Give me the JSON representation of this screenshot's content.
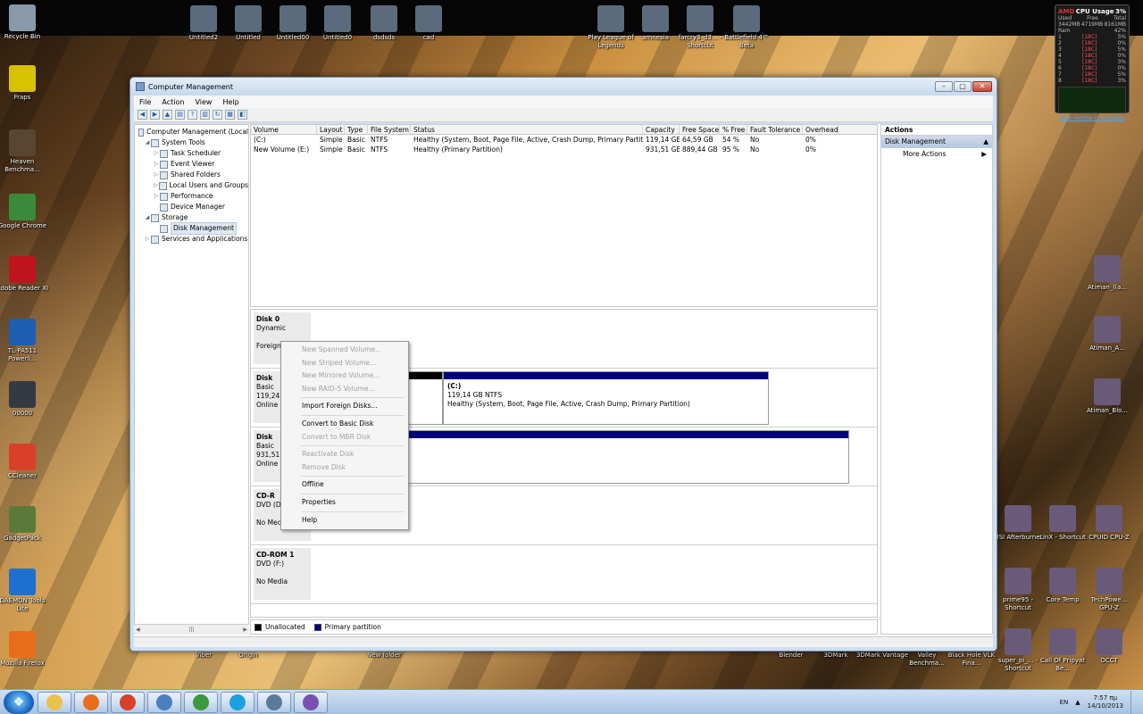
{
  "desktop": {
    "left_icons": [
      {
        "label": "Recycle Bin",
        "color": "#8899aa"
      },
      {
        "label": "Fraps",
        "color": "#d8c200"
      },
      {
        "label": "Heaven Benchma...",
        "color": "#5a4630"
      },
      {
        "label": "Google Chrome",
        "color": "#3b8a3b"
      },
      {
        "label": "Adobe Reader XI",
        "color": "#c0141c"
      },
      {
        "label": "TL-PA511 Powerli...",
        "color": "#1c5fb3"
      },
      {
        "label": "00000",
        "color": "#333a44"
      },
      {
        "label": "CCleaner",
        "color": "#d9402a"
      },
      {
        "label": "GadgetPack",
        "color": "#5a7a3a"
      },
      {
        "label": "DAEMON Tools Lite",
        "color": "#1e6fd0"
      },
      {
        "label": "Mozilla Firefox",
        "color": "#e86d1a"
      }
    ],
    "top_icons": [
      {
        "label": "Untitled2"
      },
      {
        "label": "Untitled"
      },
      {
        "label": "Untitled00"
      },
      {
        "label": "Untitled0"
      },
      {
        "label": "dsdsds"
      },
      {
        "label": "cad"
      },
      {
        "label": "Play League of Legends"
      },
      {
        "label": "amnesia"
      },
      {
        "label": "farcry3_d3... - Shortcut"
      },
      {
        "label": "Battlefield 4™ Beta"
      }
    ],
    "right_icons": [
      {
        "label": "Atiman_l(a..."
      },
      {
        "label": "Atiman_A..."
      },
      {
        "label": "Atiman_Blo..."
      },
      {
        "label": "MSI Afterburner"
      },
      {
        "label": "LinX - Shortcut"
      },
      {
        "label": "CPUID CPU-Z"
      },
      {
        "label": "prime95 - Shortcut"
      },
      {
        "label": "Core Temp"
      },
      {
        "label": "TechPowe... GPU-Z"
      },
      {
        "label": "super_pi_... - Shortcut"
      },
      {
        "label": "Call Of Pripyat Be..."
      },
      {
        "label": "OCCT"
      }
    ],
    "bottom_icons": [
      {
        "label": "Viber"
      },
      {
        "label": "Origin"
      },
      {
        "label": "New folder"
      },
      {
        "label": "Blender"
      },
      {
        "label": "3DMark"
      },
      {
        "label": "3DMark Vantage"
      },
      {
        "label": "Valley Benchma..."
      },
      {
        "label": "Black Hole VLK Fina..."
      }
    ]
  },
  "cpu_gadget": {
    "title": "CPU Usage",
    "percent": "3%",
    "brand": "AMD",
    "used_label": "Used",
    "free_label": "Free",
    "total_label": "Total",
    "used": "3442MB",
    "free": "4719MB",
    "total": "8161MB",
    "ram_label": "Ram",
    "ram_pct": "42%",
    "cores": [
      {
        "n": "1",
        "t": "[18C]",
        "p": "5%"
      },
      {
        "n": "2",
        "t": "[18C]",
        "p": "0%"
      },
      {
        "n": "3",
        "t": "[18C]",
        "p": "5%"
      },
      {
        "n": "4",
        "t": "[18C]",
        "p": "0%"
      },
      {
        "n": "5",
        "t": "[18C]",
        "p": "3%"
      },
      {
        "n": "6",
        "t": "[18C]",
        "p": "0%"
      },
      {
        "n": "7",
        "t": "[18C]",
        "p": "5%"
      },
      {
        "n": "8",
        "t": "[18C]",
        "p": "3%"
      }
    ],
    "link": "New version is available"
  },
  "window": {
    "title": "Computer Management",
    "menu": [
      "File",
      "Action",
      "View",
      "Help"
    ],
    "tree": [
      {
        "label": "Computer Management (Local",
        "level": 0,
        "exp": ""
      },
      {
        "label": "System Tools",
        "level": 1,
        "exp": "◢"
      },
      {
        "label": "Task Scheduler",
        "level": 2,
        "exp": "▷"
      },
      {
        "label": "Event Viewer",
        "level": 2,
        "exp": "▷"
      },
      {
        "label": "Shared Folders",
        "level": 2,
        "exp": "▷"
      },
      {
        "label": "Local Users and Groups",
        "level": 2,
        "exp": "▷"
      },
      {
        "label": "Performance",
        "level": 2,
        "exp": "▷"
      },
      {
        "label": "Device Manager",
        "level": 2,
        "exp": ""
      },
      {
        "label": "Storage",
        "level": 1,
        "exp": "◢"
      },
      {
        "label": "Disk Management",
        "level": 2,
        "exp": "",
        "selected": true
      },
      {
        "label": "Services and Applications",
        "level": 1,
        "exp": "▷"
      }
    ],
    "volume_columns": [
      "Volume",
      "Layout",
      "Type",
      "File System",
      "Status",
      "Capacity",
      "Free Space",
      "% Free",
      "Fault Tolerance",
      "Overhead"
    ],
    "volumes": [
      [
        "(C:)",
        "Simple",
        "Basic",
        "NTFS",
        "Healthy (System, Boot, Page File, Active, Crash Dump, Primary Partition)",
        "119,14 GB",
        "64,59 GB",
        "54 %",
        "No",
        "0%"
      ],
      [
        "New Volume (E:)",
        "Simple",
        "Basic",
        "NTFS",
        "Healthy (Primary Partition)",
        "931,51 GB",
        "889,44 GB",
        "95 %",
        "No",
        "0%"
      ]
    ],
    "disks": [
      {
        "name": "Disk 0",
        "l1": "Dynamic",
        "l2": "",
        "l3": "Foreign"
      },
      {
        "name": "Disk",
        "l1": "Basic",
        "l2": "119,24 G",
        "l3": "Online"
      },
      {
        "name": "Disk",
        "l1": "Basic",
        "l2": "931,51 G",
        "l3": "Online"
      },
      {
        "name": "CD-R",
        "l1": "DVD (D:",
        "l2": "",
        "l3": "No Med"
      },
      {
        "name": "CD-ROM 1",
        "l1": "DVD (F:)",
        "l2": "",
        "l3": "No Media"
      }
    ],
    "c_partition": {
      "name": "(C:)",
      "size": "119,14 GB NTFS",
      "status": "Healthy (System, Boot, Page File, Active, Crash Dump, Primary Partition)"
    },
    "legend": [
      {
        "label": "Unallocated",
        "color": "#000000"
      },
      {
        "label": "Primary partition",
        "color": "#000080"
      }
    ],
    "actions": {
      "header": "Actions",
      "section": "Disk Management",
      "items": [
        "More Actions"
      ]
    },
    "context_menu": [
      {
        "label": "New Spanned Volume...",
        "disabled": true
      },
      {
        "label": "New Striped Volume...",
        "disabled": true
      },
      {
        "label": "New Mirrored Volume...",
        "disabled": true
      },
      {
        "label": "New RAID-5 Volume...",
        "disabled": true
      },
      {
        "sep": true
      },
      {
        "label": "Import Foreign Disks...",
        "disabled": false
      },
      {
        "sep": true
      },
      {
        "label": "Convert to Basic Disk",
        "disabled": false
      },
      {
        "label": "Convert to MBR Disk",
        "disabled": true
      },
      {
        "sep": true
      },
      {
        "label": "Reactivate Disk",
        "disabled": true
      },
      {
        "label": "Remove Disk",
        "disabled": true
      },
      {
        "sep": true
      },
      {
        "label": "Offline",
        "disabled": false
      },
      {
        "sep": true
      },
      {
        "label": "Properties",
        "disabled": false
      },
      {
        "sep": true
      },
      {
        "label": "Help",
        "disabled": false
      }
    ]
  },
  "taskbar": {
    "apps": [
      {
        "name": "Windows Explorer",
        "color": "#e8c24a"
      },
      {
        "name": "Firefox",
        "color": "#e86d1a"
      },
      {
        "name": "Opera-like",
        "color": "#d9402a"
      },
      {
        "name": "Computer Management",
        "color": "#4a7fc0"
      },
      {
        "name": "Google Chrome",
        "color": "#3b9a3b"
      },
      {
        "name": "Skype",
        "color": "#1ea0e0"
      },
      {
        "name": "Steam-like",
        "color": "#5a7a9a"
      },
      {
        "name": "Viber",
        "color": "#7a4fb4"
      }
    ],
    "lang": "EN",
    "time": "7:57 πμ",
    "date": "14/10/2013"
  }
}
